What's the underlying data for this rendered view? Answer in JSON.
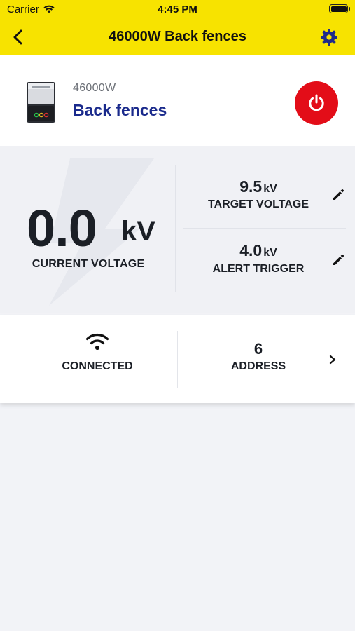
{
  "status_bar": {
    "carrier": "Carrier",
    "time": "4:45 PM",
    "wifi_icon": "wifi-icon",
    "battery_icon": "battery-icon"
  },
  "nav": {
    "title": "46000W Back fences",
    "back_icon": "chevron-left-icon",
    "settings_icon": "gear-icon"
  },
  "device": {
    "model": "46000W",
    "name": "Back fences",
    "power_icon": "power-icon"
  },
  "voltage": {
    "current_value": "0.0",
    "current_unit": "kV",
    "current_label": "CURRENT VOLTAGE",
    "target_value": "9.5",
    "target_unit": "kV",
    "target_label": "TARGET VOLTAGE",
    "alert_value": "4.0",
    "alert_unit": "kV",
    "alert_label": "ALERT TRIGGER"
  },
  "connection": {
    "status_label": "CONNECTED",
    "icon": "wifi-icon"
  },
  "address": {
    "value": "6",
    "label": "ADDRESS"
  },
  "colors": {
    "header_yellow": "#f7e300",
    "device_name_blue": "#1a2a8c",
    "power_red": "#e30d18",
    "accent_navy": "#1f2a8a",
    "text_dark": "#1b1f26",
    "panel_grey": "#f0f1f5"
  }
}
